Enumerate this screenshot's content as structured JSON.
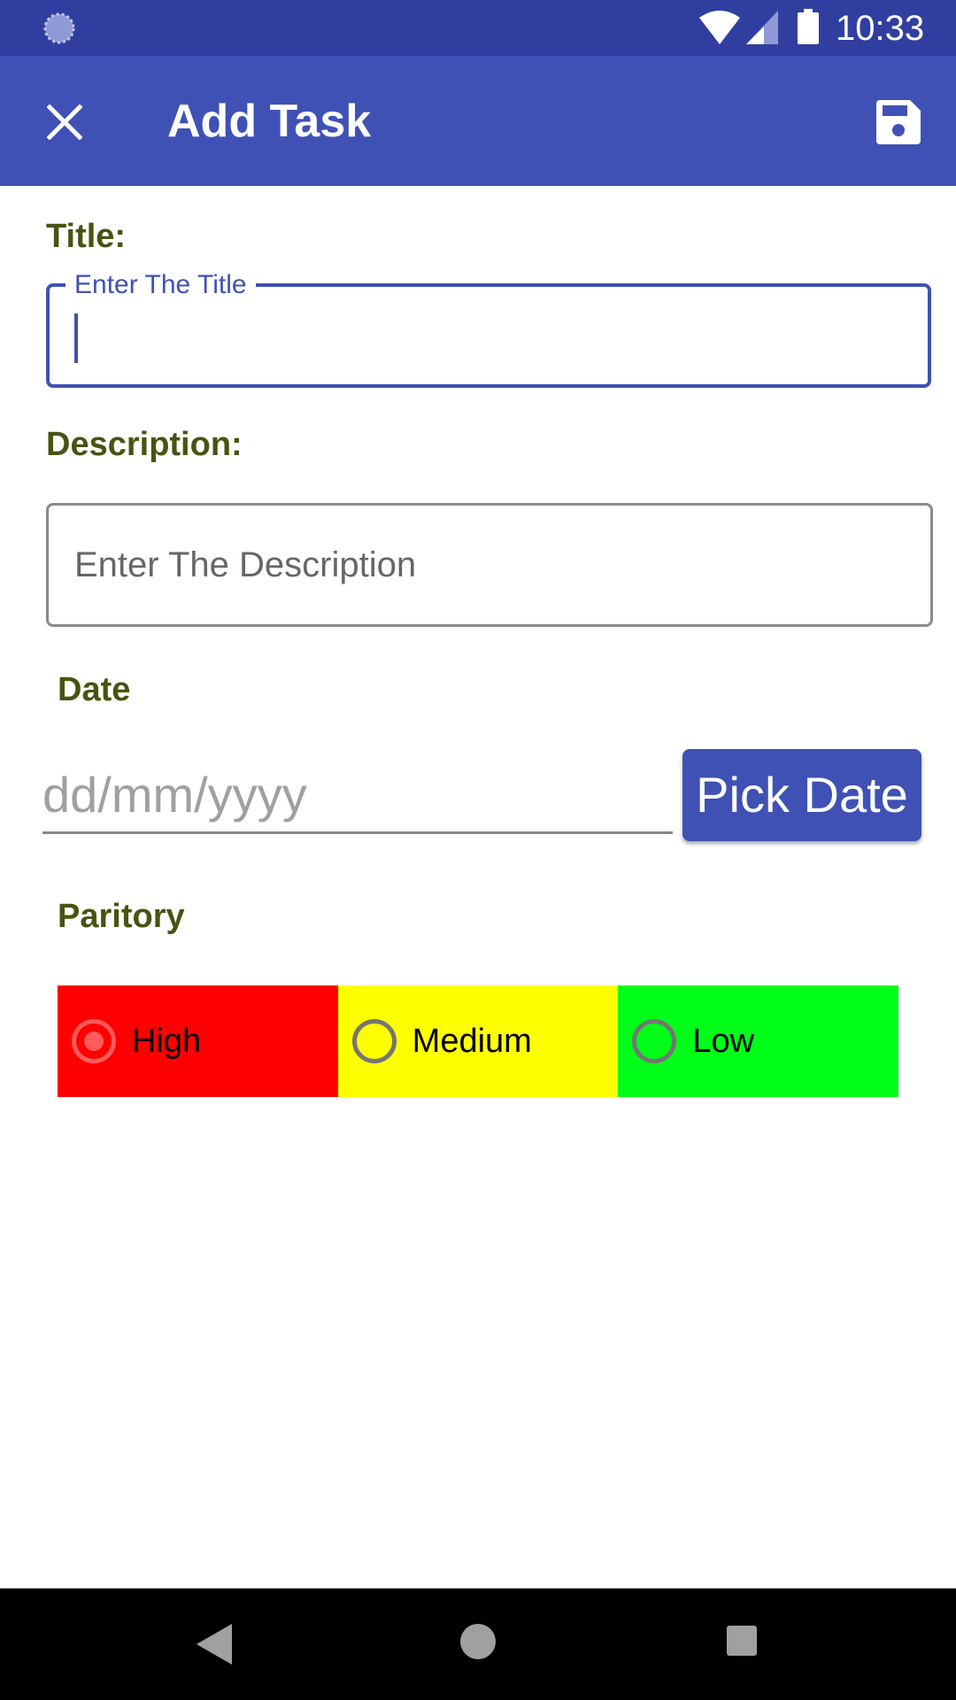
{
  "status_bar": {
    "time": "10:33",
    "icons": [
      "loading-spinner-icon",
      "wifi-icon",
      "cell-signal-icon",
      "battery-icon"
    ]
  },
  "app_bar": {
    "title": "Add Task",
    "close_icon": "close-icon",
    "save_icon": "save-icon",
    "color": "#3f51b5"
  },
  "form": {
    "title_label": "Title:",
    "title_hint": "Enter The Title",
    "title_value": "",
    "description_label": "Description:",
    "description_placeholder": "Enter The Description",
    "date_label": "Date",
    "date_placeholder": "dd/mm/yyyy",
    "pick_date_label": "Pick Date",
    "priority_label": "Paritory",
    "priority_options": [
      {
        "label": "High",
        "color": "#ff0000",
        "selected": true
      },
      {
        "label": "Medium",
        "color": "#ffff00",
        "selected": false
      },
      {
        "label": "Low",
        "color": "#00ff18",
        "selected": false
      }
    ]
  },
  "nav_bar": {
    "icons": [
      "back-icon",
      "home-icon",
      "recents-icon"
    ]
  },
  "colors": {
    "status_bar": "#303f9f",
    "accent": "#3f51b5",
    "label_text": "#4a5311"
  }
}
